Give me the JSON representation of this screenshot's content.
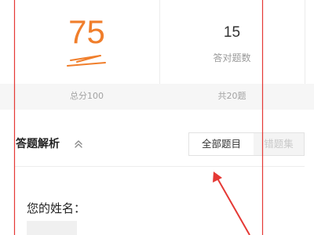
{
  "score": {
    "total_score": "75",
    "total_label": "总分100",
    "correct_count": "15",
    "correct_label": "答对题数",
    "question_total": "共20题"
  },
  "analysis": {
    "title": "答题解析",
    "collapse_icon": "double-chevron-up-icon",
    "tabs": [
      {
        "label": "全部题目",
        "active": true
      },
      {
        "label": "错题集",
        "active": false
      }
    ]
  },
  "question": {
    "prompt": "您的姓名："
  },
  "colors": {
    "accent_orange": "#f07e2b",
    "annotation_red": "#e53935",
    "muted_gray": "#9a9a9a"
  }
}
